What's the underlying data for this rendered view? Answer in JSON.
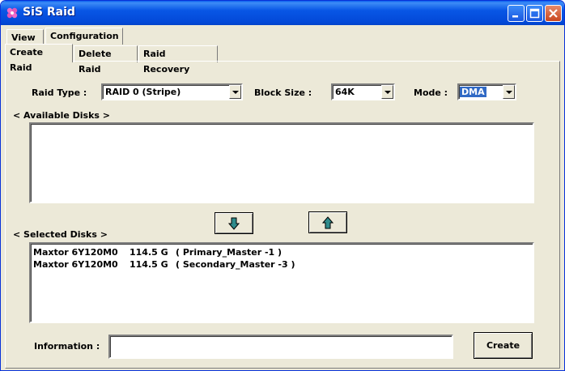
{
  "window": {
    "title": "SiS Raid"
  },
  "menu_tabs": [
    {
      "label": "View"
    },
    {
      "label": "Configuration"
    }
  ],
  "sub_tabs": [
    {
      "label": "Create Raid"
    },
    {
      "label": "Delete Raid"
    },
    {
      "label": "Raid Recovery"
    }
  ],
  "form": {
    "raid_type_label": "Raid Type :",
    "raid_type_value": "RAID 0 (Stripe)",
    "block_size_label": "Block Size :",
    "block_size_value": "64K",
    "mode_label": "Mode :",
    "mode_value": "DMA"
  },
  "available_disks": {
    "label": "< Available Disks >",
    "items": []
  },
  "selected_disks": {
    "label": "< Selected Disks >",
    "items": [
      {
        "model": "Maxtor 6Y120M0",
        "size": "114.5 G",
        "location": "( Primary_Master -1 )"
      },
      {
        "model": "Maxtor 6Y120M0",
        "size": "114.5 G",
        "location": "( Secondary_Master -3 )"
      }
    ]
  },
  "information": {
    "label": "Information :",
    "value": ""
  },
  "buttons": {
    "create": "Create",
    "move_down_icon": "arrow-down-icon",
    "move_up_icon": "arrow-up-icon"
  },
  "colors": {
    "title_bar": "#0856E5",
    "face": "#ECE9D8",
    "selection": "#316AC5",
    "arrow_teal": "#2E8B8B"
  }
}
